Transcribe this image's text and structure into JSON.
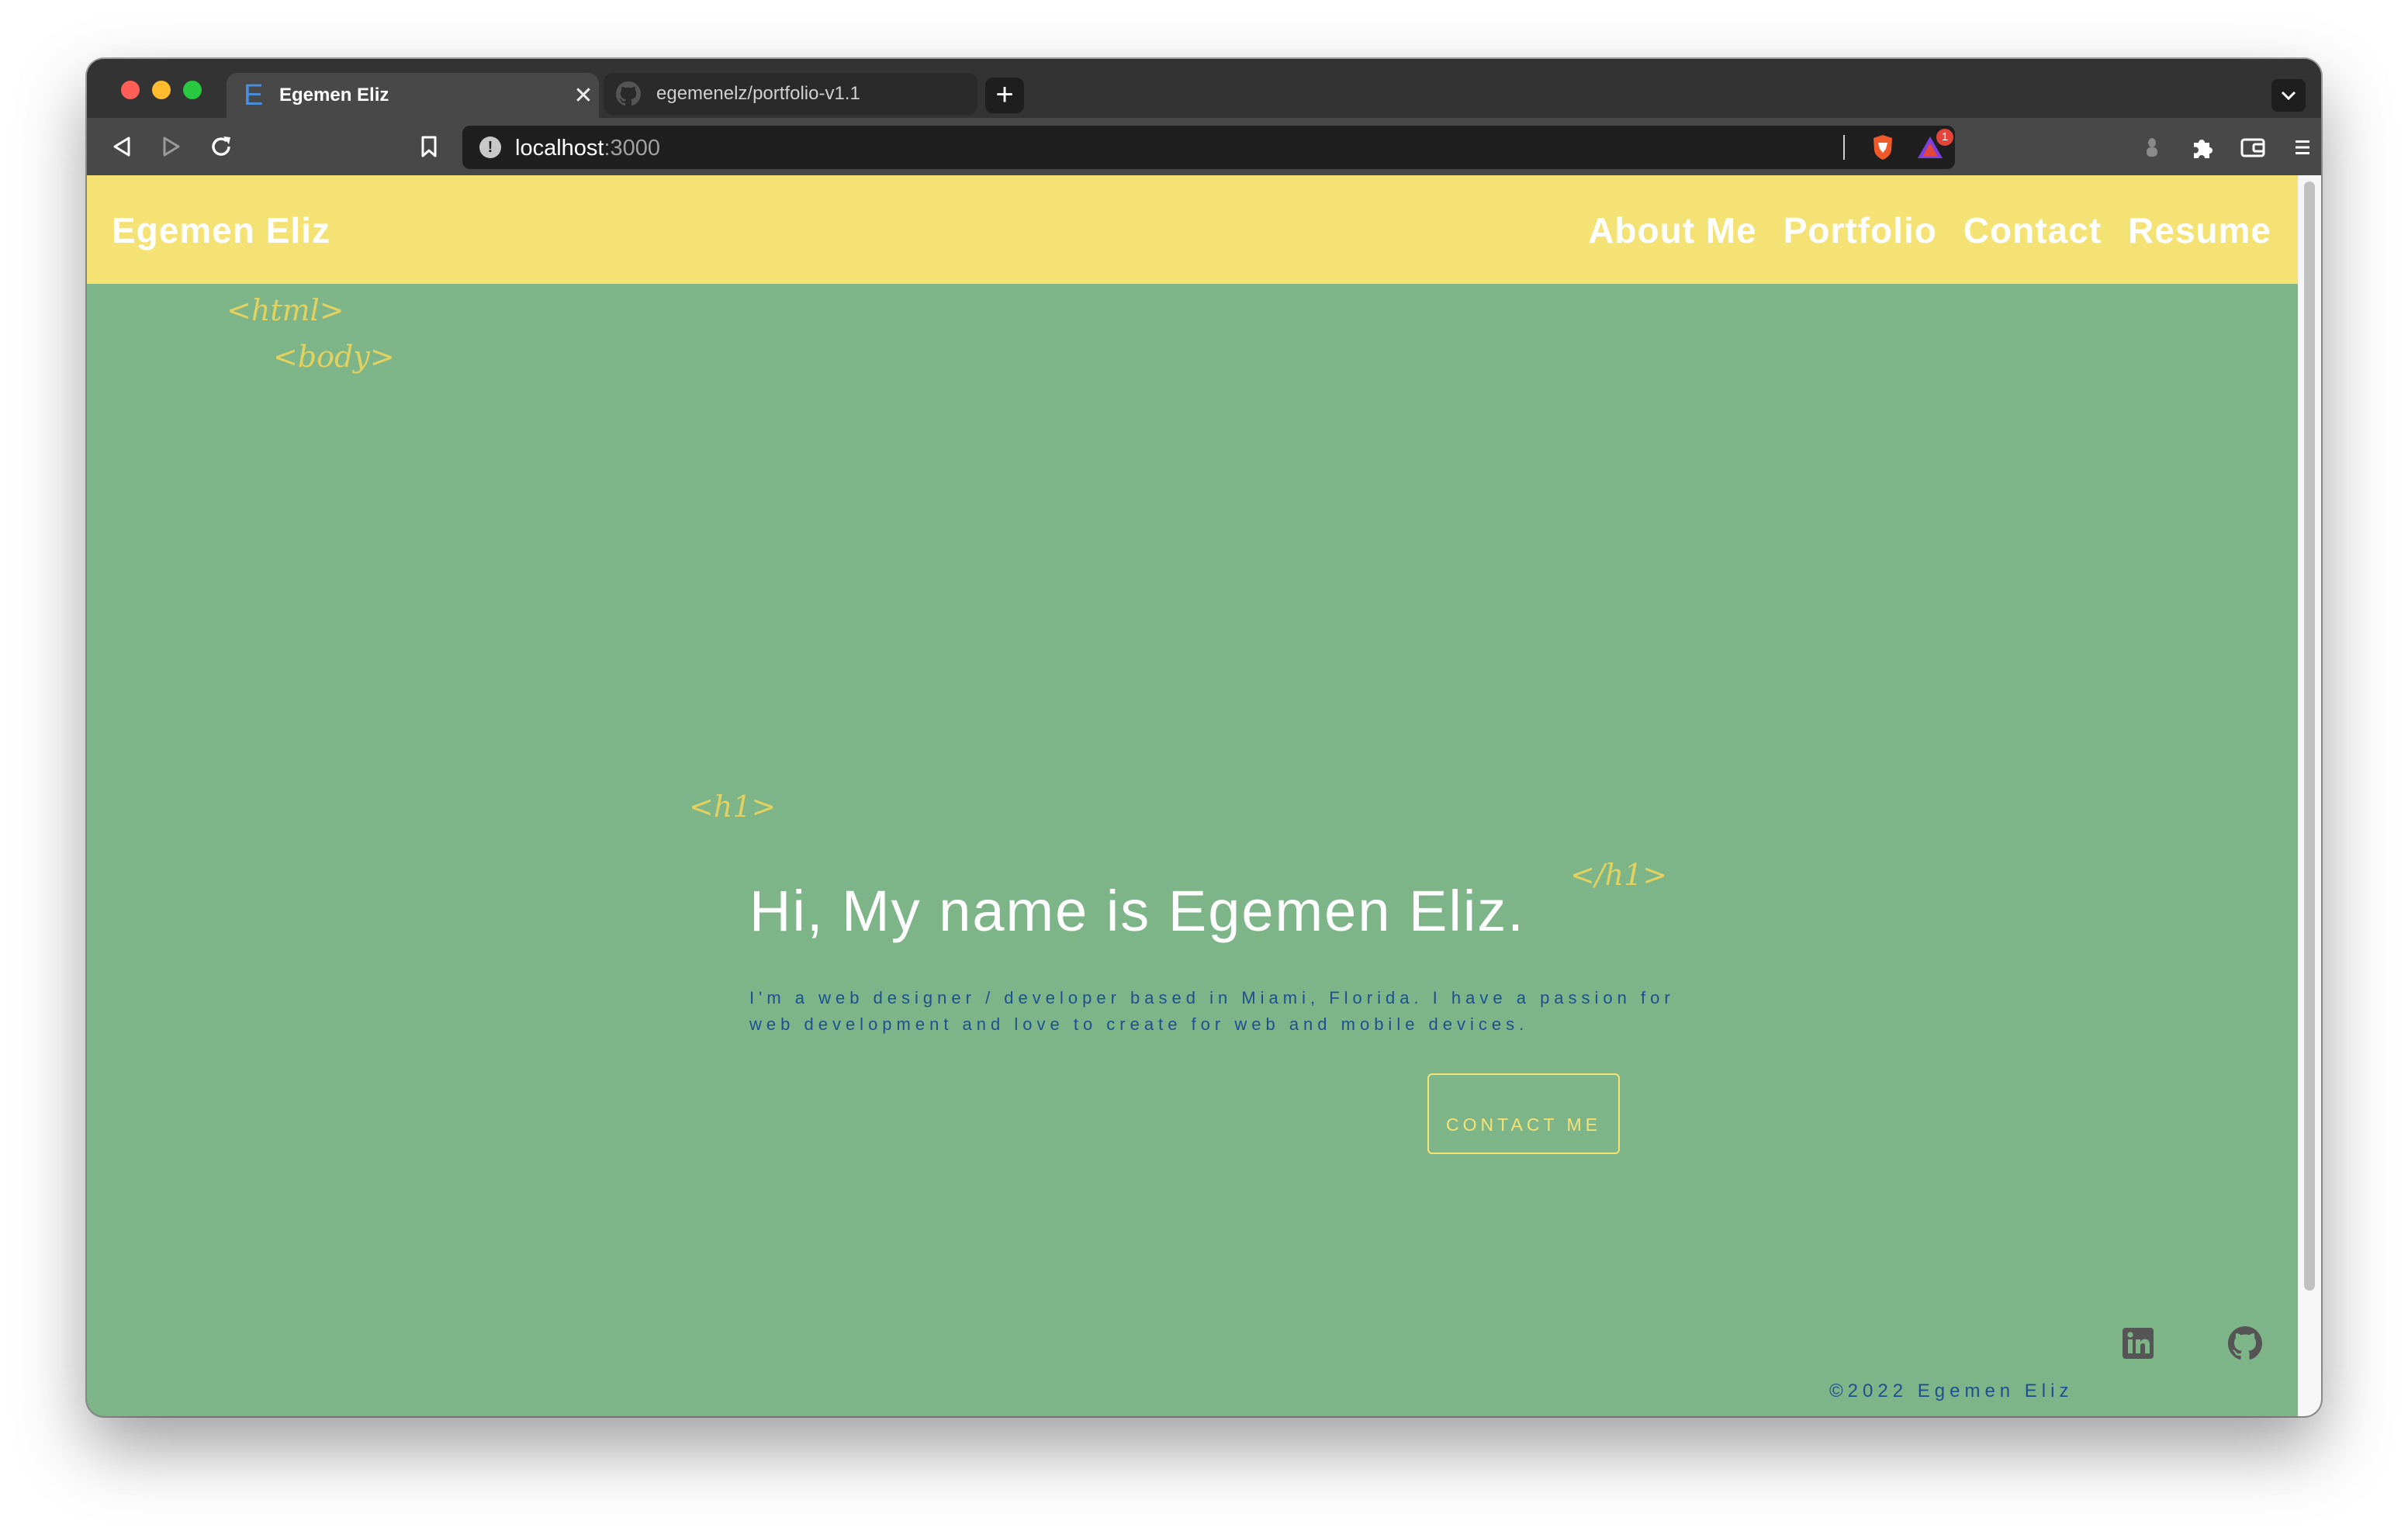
{
  "browser": {
    "tabs": [
      {
        "title": "Egemen Eliz",
        "favicon": "E",
        "active": true
      },
      {
        "title": "egemenelz/portfolio-v1.1",
        "favicon": "github-icon",
        "active": false
      }
    ],
    "new_tab": "+",
    "close_glyph": "✕",
    "address": {
      "host": "localhost",
      "port": ":3000"
    },
    "rewards_badge": "1"
  },
  "site": {
    "brand": "Egemen Eliz",
    "nav": [
      "About Me",
      "Portfolio",
      "Contact",
      "Resume"
    ],
    "tags": {
      "html_open": "<html>",
      "body_open": "<body>",
      "h1_open": "<h1>",
      "h1_close": "</h1>"
    },
    "hero": {
      "title": "Hi, My name is Egemen Eliz.",
      "subtitle": "I'm a web designer / developer based in Miami, Florida. I have a passion for web development and love to create for web and mobile devices.",
      "cta": "CONTACT ME"
    },
    "footer": {
      "copyright": "©2022 Egemen Eliz",
      "social": [
        "linkedin-icon",
        "github-icon"
      ]
    }
  },
  "colors": {
    "header_bg": "#f4e274",
    "page_bg": "#7db588",
    "accent_text": "#1f4f92",
    "tag_color": "#e3d15f"
  }
}
